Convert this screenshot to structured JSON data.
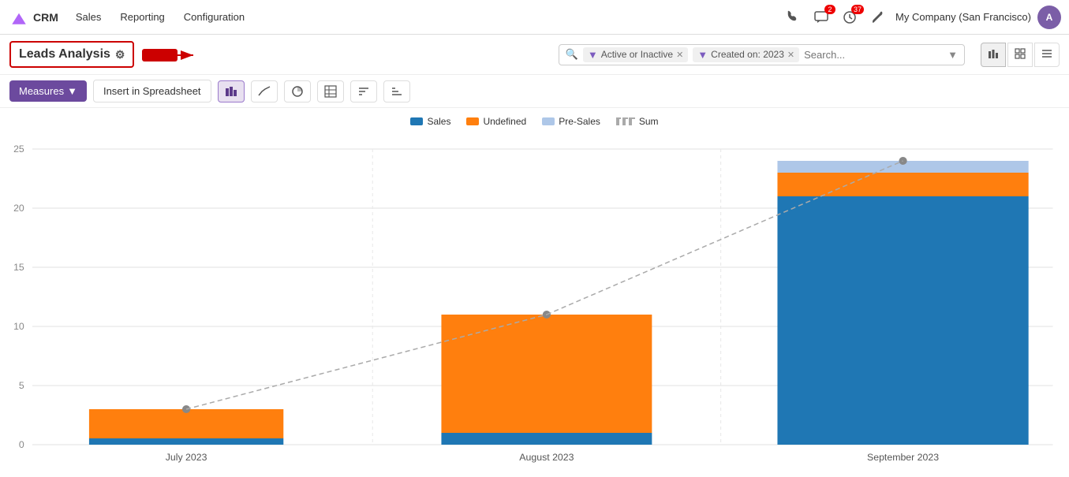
{
  "navbar": {
    "logo_text": "CRM",
    "nav_items": [
      "CRM",
      "Sales",
      "Reporting",
      "Configuration"
    ],
    "notifications": [
      {
        "icon": "phone-icon",
        "badge": null
      },
      {
        "icon": "chat-icon",
        "badge": "2"
      },
      {
        "icon": "activity-icon",
        "badge": "37"
      }
    ],
    "company": "My Company (San Francisco)",
    "avatar_initials": "A"
  },
  "page_title": "Leads Analysis",
  "settings_icon": "⚙",
  "arrow_annotation": "←",
  "filters": [
    {
      "icon": "🔍",
      "label": ""
    },
    {
      "type": "filter",
      "icon": "▼",
      "label": "Active or Inactive",
      "removable": true
    },
    {
      "type": "filter",
      "icon": "▼",
      "label": "Created on: 2023",
      "removable": true
    }
  ],
  "search_placeholder": "Search...",
  "toolbar": {
    "measures_label": "Measures",
    "spreadsheet_label": "Insert in Spreadsheet",
    "chart_types": [
      {
        "id": "bar",
        "icon": "▐▌",
        "active": true
      },
      {
        "id": "line",
        "icon": "📈",
        "active": false
      },
      {
        "id": "pie",
        "icon": "◔",
        "active": false
      },
      {
        "id": "table",
        "icon": "⊞",
        "active": false
      },
      {
        "id": "desc",
        "icon": "↕",
        "active": false
      },
      {
        "id": "asc",
        "icon": "↕",
        "active": false
      }
    ]
  },
  "legend": [
    {
      "label": "Sales",
      "color": "#1f77b4"
    },
    {
      "label": "Undefined",
      "color": "#ff7f0e"
    },
    {
      "label": "Pre-Sales",
      "color": "#aec7e8"
    },
    {
      "label": "Sum",
      "color": "#aaaaaa",
      "dashed": true
    }
  ],
  "chart": {
    "y_labels": [
      "0",
      "5",
      "10",
      "15",
      "20",
      "25"
    ],
    "x_labels": [
      "July 2023",
      "August 2023",
      "September 2023"
    ],
    "bars": [
      {
        "month": "July 2023",
        "sales": 0.5,
        "undefined": 2.5,
        "presales": 0,
        "sum": 3
      },
      {
        "month": "August 2023",
        "sales": 1,
        "undefined": 10,
        "presales": 0,
        "sum": 11
      },
      {
        "month": "September 2023",
        "sales": 21,
        "undefined": 2,
        "presales": 1,
        "sum": 24
      }
    ],
    "max_y": 25,
    "colors": {
      "sales": "#1f77b4",
      "undefined": "#ff7f0e",
      "presales": "#aec7e8",
      "sum_dot": "#888888"
    }
  },
  "view_buttons": [
    {
      "id": "graph",
      "icon": "▐▌",
      "active": true
    },
    {
      "id": "grid",
      "icon": "⊞",
      "active": false
    },
    {
      "id": "list",
      "icon": "≡",
      "active": false
    }
  ]
}
